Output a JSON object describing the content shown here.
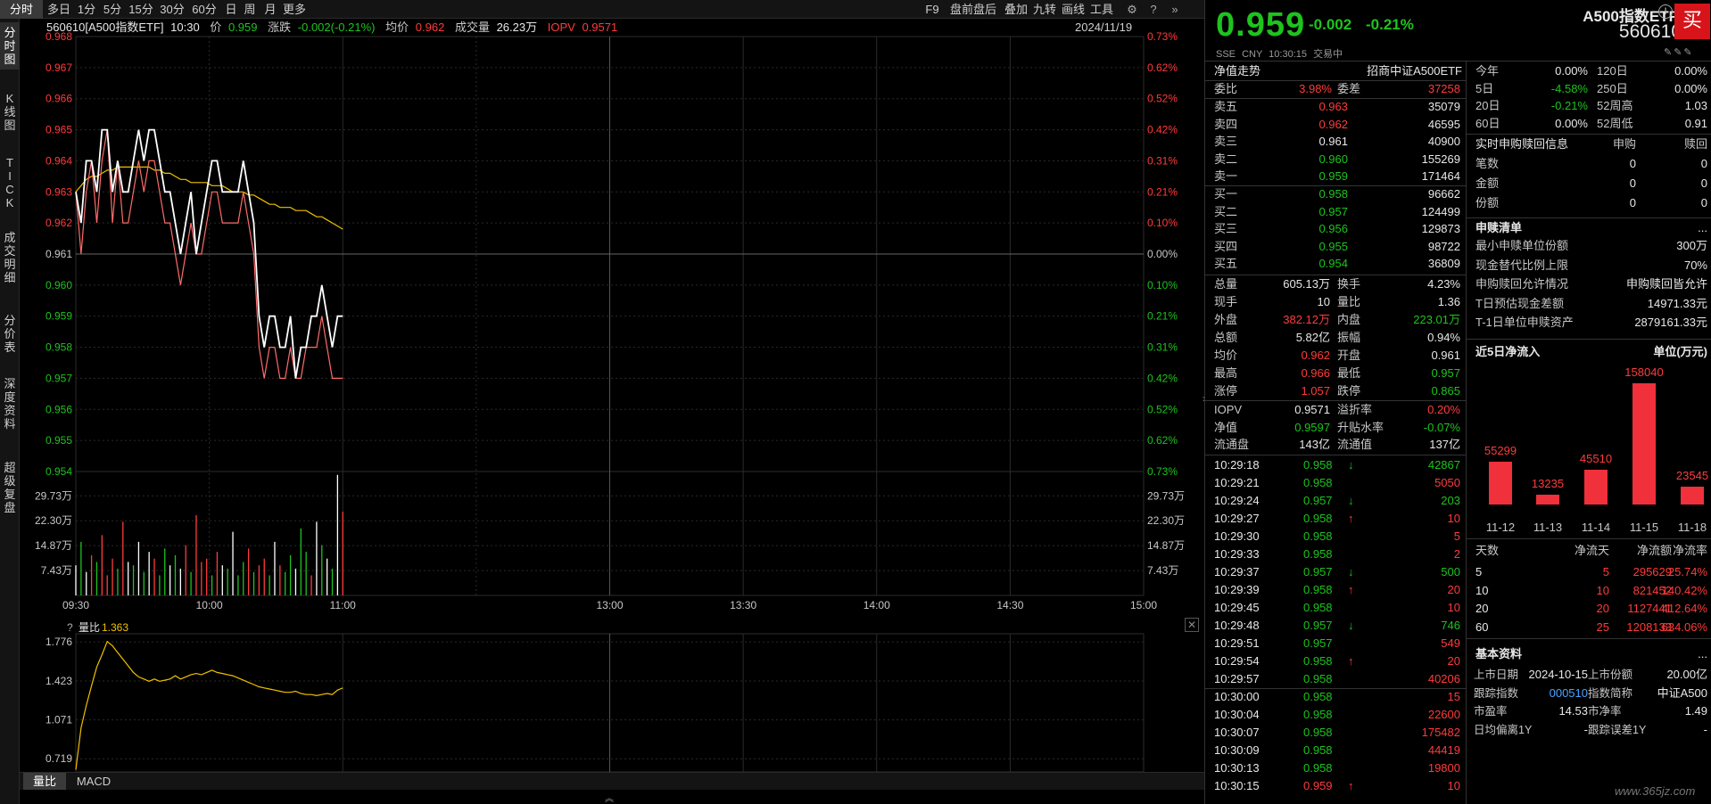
{
  "toolbar": {
    "left": [
      "分时",
      "多日",
      "1分",
      "5分",
      "15分",
      "30分",
      "60分",
      "日",
      "周",
      "月",
      "更多"
    ],
    "right": [
      "F9",
      "盘前盘后",
      "叠加",
      "九转",
      "画线",
      "工具"
    ]
  },
  "sidebar": [
    "分\n时\n图",
    "K\n线\n图",
    "T\nI\nC\nK",
    "成\n交\n明\n细",
    "分\n价\n表",
    "深\n度\n资\n料",
    "超\n级\n复\n盘"
  ],
  "info": {
    "code": "560610[A500指数ETF]",
    "time": "10:30",
    "price_label": "价",
    "price": "0.959",
    "chg_label": "涨跌",
    "chg": "-0.002(-0.21%)",
    "avg_label": "均价",
    "avg": "0.962",
    "vol_label": "成交量",
    "vol": "26.23万",
    "iopv_label": "IOPV",
    "iopv": "0.9571",
    "date": "2024/11/19"
  },
  "colors": {
    "up": "#ff3b3b",
    "down": "#1ec31e",
    "price_line": "#ffffff",
    "avg_line": "#f0c000",
    "bg": "#000000",
    "grid": "#2b2b2b"
  },
  "chart_data": [
    {
      "type": "line",
      "name": "price",
      "ylim": [
        0.954,
        0.968
      ],
      "y_ticks": [
        "0.968",
        "0.967",
        "0.966",
        "0.965",
        "0.964",
        "0.963",
        "0.962",
        "0.961",
        "0.960",
        "0.959",
        "0.958",
        "0.957",
        "0.956",
        "0.955",
        "0.954"
      ],
      "pct_ticks": [
        "0.73%",
        "0.62%",
        "0.52%",
        "0.42%",
        "0.31%",
        "0.21%",
        "0.10%",
        "0.00%",
        "0.10%",
        "0.21%",
        "0.31%",
        "0.42%",
        "0.52%",
        "0.62%",
        "0.73%"
      ],
      "x_ticks": [
        "09:30",
        "10:00",
        "11:00",
        "13:00",
        "13:30",
        "14:00",
        "14:30",
        "15:00"
      ],
      "price": [
        0.963,
        0.962,
        0.964,
        0.964,
        0.963,
        0.965,
        0.965,
        0.963,
        0.964,
        0.963,
        0.963,
        0.964,
        0.965,
        0.964,
        0.965,
        0.965,
        0.964,
        0.963,
        0.963,
        0.962,
        0.961,
        0.962,
        0.963,
        0.961,
        0.962,
        0.963,
        0.964,
        0.964,
        0.963,
        0.963,
        0.963,
        0.963,
        0.964,
        0.963,
        0.962,
        0.959,
        0.958,
        0.959,
        0.959,
        0.958,
        0.958,
        0.959,
        0.957,
        0.958,
        0.958,
        0.959,
        0.959,
        0.96,
        0.959,
        0.958,
        0.959,
        0.959
      ],
      "iopv": [
        0.963,
        0.961,
        0.963,
        0.964,
        0.962,
        0.964,
        0.965,
        0.962,
        0.964,
        0.962,
        0.962,
        0.963,
        0.964,
        0.963,
        0.964,
        0.964,
        0.963,
        0.962,
        0.962,
        0.961,
        0.96,
        0.961,
        0.962,
        0.961,
        0.961,
        0.962,
        0.963,
        0.963,
        0.962,
        0.962,
        0.962,
        0.962,
        0.963,
        0.962,
        0.961,
        0.958,
        0.957,
        0.958,
        0.958,
        0.957,
        0.957,
        0.958,
        0.957,
        0.957,
        0.958,
        0.958,
        0.958,
        0.959,
        0.958,
        0.957,
        0.957,
        0.957
      ],
      "avg": [
        0.963,
        0.9632,
        0.9634,
        0.9635,
        0.9635,
        0.9636,
        0.9637,
        0.9637,
        0.9638,
        0.9638,
        0.9638,
        0.9638,
        0.9638,
        0.9638,
        0.9638,
        0.9637,
        0.9637,
        0.9636,
        0.9636,
        0.9635,
        0.9634,
        0.9634,
        0.9633,
        0.9633,
        0.9633,
        0.9633,
        0.9632,
        0.9632,
        0.9632,
        0.9631,
        0.963,
        0.963,
        0.963,
        0.9629,
        0.9629,
        0.9628,
        0.9627,
        0.9626,
        0.9626,
        0.9625,
        0.9625,
        0.9625,
        0.9624,
        0.9624,
        0.9624,
        0.9623,
        0.9622,
        0.9622,
        0.9621,
        0.962,
        0.9619,
        0.9618
      ]
    },
    {
      "type": "bar",
      "name": "volume",
      "y_ticks": [
        "29.73万",
        "22.30万",
        "14.87万",
        "7.43万"
      ],
      "ylim": [
        0,
        37
      ],
      "values": [
        9,
        16,
        7,
        12,
        10,
        18,
        6,
        11,
        8,
        22,
        10,
        9,
        16,
        7,
        13,
        11,
        6,
        14,
        9,
        12,
        8,
        15,
        7,
        24,
        10,
        11,
        6,
        13,
        9,
        8,
        19,
        6,
        10,
        14,
        7,
        9,
        11,
        6,
        16,
        9,
        7,
        12,
        8,
        20,
        13,
        6,
        22,
        15,
        11,
        8,
        36,
        25
      ],
      "dirs": [
        "u",
        "d",
        "u",
        "u",
        "d",
        "u",
        "d",
        "u",
        "d",
        "u",
        "u",
        "d",
        "u",
        "d",
        "u",
        "u",
        "d",
        "d",
        "u",
        "d",
        "u",
        "u",
        "d",
        "u",
        "d",
        "u",
        "d",
        "d",
        "u",
        "d",
        "u",
        "d",
        "d",
        "u",
        "d",
        "u",
        "d",
        "d",
        "u",
        "u",
        "d",
        "d",
        "u",
        "d",
        "d",
        "u",
        "u",
        "d",
        "u",
        "d",
        "u",
        "u"
      ]
    },
    {
      "type": "line",
      "name": "量比",
      "value_label": "1.363",
      "ylim": [
        0.6,
        1.85
      ],
      "y_ticks": [
        "1.776",
        "1.423",
        "1.071",
        "0.719"
      ],
      "values": [
        0.62,
        1.0,
        1.2,
        1.38,
        1.55,
        1.66,
        1.78,
        1.74,
        1.68,
        1.62,
        1.56,
        1.5,
        1.46,
        1.44,
        1.42,
        1.44,
        1.42,
        1.43,
        1.44,
        1.47,
        1.44,
        1.46,
        1.48,
        1.49,
        1.48,
        1.5,
        1.52,
        1.5,
        1.49,
        1.48,
        1.47,
        1.45,
        1.43,
        1.41,
        1.39,
        1.37,
        1.36,
        1.35,
        1.34,
        1.33,
        1.32,
        1.32,
        1.33,
        1.31,
        1.3,
        1.3,
        1.29,
        1.3,
        1.31,
        1.3,
        1.34,
        1.36
      ]
    }
  ],
  "sub_tabs": [
    "量比",
    "MACD"
  ],
  "right": {
    "price": "0.959",
    "chg": "-0.002",
    "chg_pct": "-0.21%",
    "name": "A500指数ETF",
    "code": "560610",
    "buy": "买",
    "meta": [
      "SSE",
      "CNY",
      "10:30:15",
      "交易中"
    ],
    "nav_title": "净值走势",
    "nav_name": "招商中证A500ETF",
    "webi": {
      "label": "委比",
      "value": "3.98%",
      "label2": "委差",
      "value2": "37258"
    },
    "asks": [
      [
        "卖五",
        "0.963",
        "35079"
      ],
      [
        "卖四",
        "0.962",
        "46595"
      ],
      [
        "卖三",
        "0.961",
        "40900"
      ],
      [
        "卖二",
        "0.960",
        "155269"
      ],
      [
        "卖一",
        "0.959",
        "171464"
      ]
    ],
    "bids": [
      [
        "买一",
        "0.958",
        "96662"
      ],
      [
        "买二",
        "0.957",
        "124499"
      ],
      [
        "买三",
        "0.956",
        "129873"
      ],
      [
        "买四",
        "0.955",
        "98722"
      ],
      [
        "买五",
        "0.954",
        "36809"
      ]
    ],
    "stats": [
      [
        "总量",
        "605.13万",
        "换手",
        "4.23%"
      ],
      [
        "现手",
        "10",
        "量比",
        "1.36"
      ],
      [
        "外盘",
        "382.12万",
        "内盘",
        "223.01万"
      ],
      [
        "总额",
        "5.82亿",
        "振幅",
        "0.94%"
      ],
      [
        "均价",
        "0.962",
        "开盘",
        "0.961"
      ],
      [
        "最高",
        "0.966",
        "最低",
        "0.957"
      ],
      [
        "涨停",
        "1.057",
        "跌停",
        "0.865"
      ]
    ],
    "stats2": [
      [
        "IOPV",
        "0.9571",
        "溢折率",
        "0.20%"
      ],
      [
        "净值",
        "0.9597",
        "升贴水率",
        "-0.07%"
      ],
      [
        "流通盘",
        "143亿",
        "流通值",
        "137亿"
      ]
    ],
    "ticks": [
      [
        "10:29:18",
        "0.958",
        "↓",
        "42867"
      ],
      [
        "10:29:21",
        "0.958",
        "",
        "5050"
      ],
      [
        "10:29:24",
        "0.957",
        "↓",
        "203"
      ],
      [
        "10:29:27",
        "0.958",
        "↑",
        "10"
      ],
      [
        "10:29:30",
        "0.958",
        "",
        "5"
      ],
      [
        "10:29:33",
        "0.958",
        "",
        "2"
      ],
      [
        "10:29:37",
        "0.957",
        "↓",
        "500"
      ],
      [
        "10:29:39",
        "0.958",
        "↑",
        "20"
      ],
      [
        "10:29:45",
        "0.958",
        "",
        "10"
      ],
      [
        "10:29:48",
        "0.957",
        "↓",
        "746"
      ],
      [
        "10:29:51",
        "0.957",
        "",
        "549"
      ],
      [
        "10:29:54",
        "0.958",
        "↑",
        "20"
      ],
      [
        "10:29:57",
        "0.958",
        "",
        "40206"
      ],
      [
        "10:30:00",
        "0.958",
        "",
        "15"
      ],
      [
        "10:30:04",
        "0.958",
        "",
        "22600"
      ],
      [
        "10:30:07",
        "0.958",
        "",
        "175482"
      ],
      [
        "10:30:09",
        "0.958",
        "",
        "44419"
      ],
      [
        "10:30:13",
        "0.958",
        "",
        "19800"
      ],
      [
        "10:30:15",
        "0.959",
        "↑",
        "10"
      ]
    ],
    "perf": [
      [
        "今年",
        "0.00%",
        "120日",
        "0.00%"
      ],
      [
        "5日",
        "-4.58%",
        "250日",
        "0.00%"
      ],
      [
        "20日",
        "-0.21%",
        "52周高",
        "1.03"
      ],
      [
        "60日",
        "0.00%",
        "52周低",
        "0.91"
      ]
    ],
    "sg_title": "实时申购赎回信息",
    "sg_cols": [
      "申购",
      "赎回"
    ],
    "sg": [
      [
        "笔数",
        "0",
        "0"
      ],
      [
        "金额",
        "0",
        "0"
      ],
      [
        "份额",
        "0",
        "0"
      ]
    ],
    "list_title": "申赎清单",
    "list_more": "...",
    "list": [
      [
        "最小申赎单位份额",
        "300万"
      ],
      [
        "现金替代比例上限",
        "70%"
      ],
      [
        "申购赎回允许情况",
        "申购赎回皆允许"
      ],
      [
        "T日预估现金差额",
        "14971.33元"
      ],
      [
        "T-1日单位申赎资产",
        "2879161.33元"
      ]
    ],
    "flow_title": "近5日净流入",
    "flow_unit": "单位(万元)",
    "flow_chart": {
      "type": "bar",
      "categories": [
        "11-12",
        "11-13",
        "11-14",
        "11-15",
        "11-18"
      ],
      "values": [
        55299,
        13235,
        45510,
        158040,
        23545
      ]
    },
    "flow_cols": [
      "天数",
      "净流天",
      "净流额",
      "净流率"
    ],
    "flow_rows": [
      [
        "5",
        "5",
        "295629",
        "25.74%"
      ],
      [
        "10",
        "10",
        "821452",
        "140.42%"
      ],
      [
        "20",
        "20",
        "1127441",
        "412.64%"
      ],
      [
        "60",
        "25",
        "1208133",
        "634.06%"
      ]
    ],
    "basic_title": "基本资料",
    "basic_more": "...",
    "basic": [
      [
        "上市日期",
        "2024-10-15",
        "上市份额",
        "20.00亿"
      ],
      [
        "跟踪指数",
        "000510",
        "指数简称",
        "中证A500"
      ],
      [
        "市盈率",
        "14.53",
        "市净率",
        "1.49"
      ],
      [
        "日均偏离1Y",
        "-",
        "跟踪误差1Y",
        "-"
      ]
    ],
    "watermark": "www.365jz.com"
  }
}
